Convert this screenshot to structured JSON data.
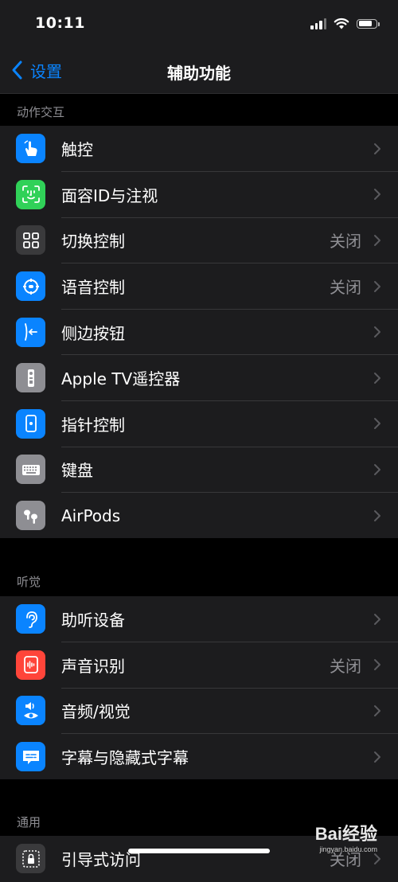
{
  "status_bar": {
    "time": "10:11"
  },
  "nav": {
    "back_label": "设置",
    "title": "辅助功能"
  },
  "sections": [
    {
      "header": "动作交互",
      "items": [
        {
          "label": "触控",
          "value": "",
          "icon": "hand-touch-icon",
          "icon_color": "#0a84ff"
        },
        {
          "label": "面容ID与注视",
          "value": "",
          "icon": "face-id-icon",
          "icon_color": "#30d158"
        },
        {
          "label": "切换控制",
          "value": "关闭",
          "icon": "switch-control-icon",
          "icon_color": "#3a3a3c"
        },
        {
          "label": "语音控制",
          "value": "关闭",
          "icon": "voice-control-icon",
          "icon_color": "#0a84ff"
        },
        {
          "label": "侧边按钮",
          "value": "",
          "icon": "side-button-icon",
          "icon_color": "#0a84ff"
        },
        {
          "label": "Apple TV遥控器",
          "value": "",
          "icon": "remote-icon",
          "icon_color": "#8e8e93"
        },
        {
          "label": "指针控制",
          "value": "",
          "icon": "pointer-control-icon",
          "icon_color": "#0a84ff"
        },
        {
          "label": "键盘",
          "value": "",
          "icon": "keyboard-icon",
          "icon_color": "#8e8e93"
        },
        {
          "label": "AirPods",
          "value": "",
          "icon": "airpods-icon",
          "icon_color": "#8e8e93"
        }
      ]
    },
    {
      "header": "听觉",
      "items": [
        {
          "label": "助听设备",
          "value": "",
          "icon": "ear-icon",
          "icon_color": "#0a84ff"
        },
        {
          "label": "声音识别",
          "value": "关闭",
          "icon": "sound-recognition-icon",
          "icon_color": "#ff453a"
        },
        {
          "label": "音频/视觉",
          "value": "",
          "icon": "audio-visual-icon",
          "icon_color": "#0a84ff"
        },
        {
          "label": "字幕与隐藏式字幕",
          "value": "",
          "icon": "subtitles-icon",
          "icon_color": "#0a84ff"
        }
      ]
    },
    {
      "header": "通用",
      "items": [
        {
          "label": "引导式访问",
          "value": "关闭",
          "icon": "guided-access-icon",
          "icon_color": "#3a3a3c"
        }
      ]
    }
  ],
  "watermark": {
    "logo": "Bai经验",
    "url": "jingyan.baidu.com"
  }
}
